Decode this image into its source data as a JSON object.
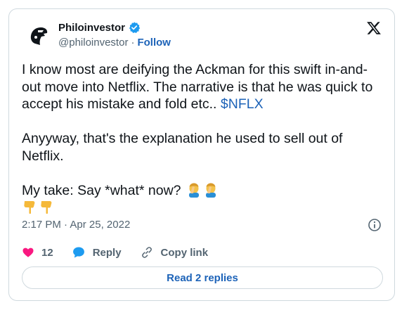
{
  "author": {
    "display_name": "Philoinvestor",
    "handle": "@philoinvestor",
    "separator": "·",
    "follow_label": "Follow",
    "avatar_icon": "helmet-logo-icon",
    "verified_icon": "verified-badge-icon"
  },
  "platform_icon": "x-logo-icon",
  "tweet": {
    "line1": "I know most are deifying the Ackman for this swift in-and-out move into Netflix. The narrative is that he was quick to accept his mistake and fold etc.. ",
    "cashtag": "$NFLX",
    "line2": "Anyyway, that's the explanation he used to sell out of Netflix.",
    "line3": "My take: Say *what* now?",
    "emojis_line3": [
      "man-facepalming-emoji",
      "man-facepalming-emoji"
    ],
    "emojis_line4": [
      "backhand-index-pointing-down-emoji",
      "backhand-index-pointing-down-emoji"
    ]
  },
  "meta": {
    "time": "2:17 PM",
    "separator": "·",
    "date": "Apr 25, 2022",
    "info_icon": "info-icon"
  },
  "actions": {
    "like_count": "12",
    "reply_label": "Reply",
    "copy_link_label": "Copy link"
  },
  "read_replies_label": "Read 2 replies",
  "colors": {
    "accent": "#1d63b8",
    "verified": "#1d9bf0",
    "heart": "#f91880",
    "secondary_text": "#536471",
    "border": "#cfd9de"
  }
}
